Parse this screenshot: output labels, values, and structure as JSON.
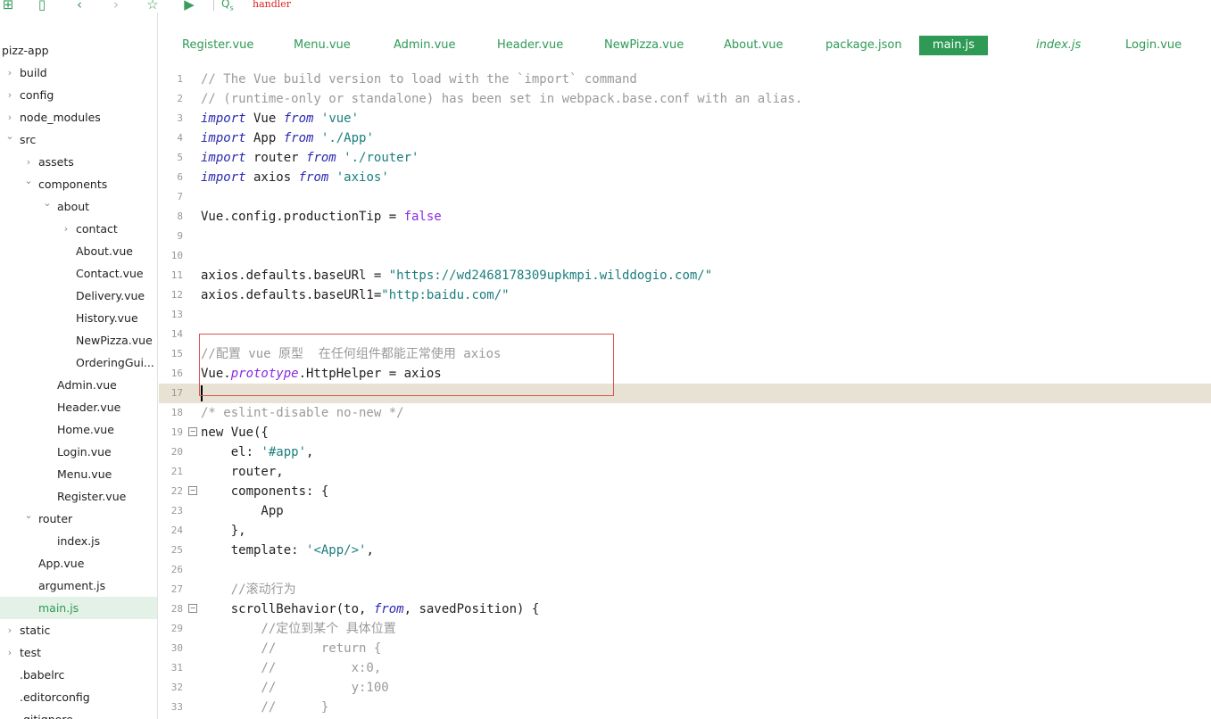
{
  "toolbar": {
    "search_text": "handler",
    "icons": [
      "new-file-icon",
      "save-icon",
      "back-icon",
      "forward-icon",
      "star-icon",
      "run-icon",
      "search-icon"
    ]
  },
  "sidebar": {
    "items": [
      {
        "label": "pizz-app",
        "indent": 0,
        "chevron": ""
      },
      {
        "label": "build",
        "indent": 1,
        "chevron": ">"
      },
      {
        "label": "config",
        "indent": 1,
        "chevron": ">"
      },
      {
        "label": "node_modules",
        "indent": 1,
        "chevron": ">"
      },
      {
        "label": "src",
        "indent": 1,
        "chevron": "v"
      },
      {
        "label": "assets",
        "indent": 2,
        "chevron": ">"
      },
      {
        "label": "components",
        "indent": 2,
        "chevron": "v"
      },
      {
        "label": "about",
        "indent": 3,
        "chevron": "v"
      },
      {
        "label": "contact",
        "indent": 4,
        "chevron": ">"
      },
      {
        "label": "About.vue",
        "indent": 4,
        "chevron": ""
      },
      {
        "label": "Contact.vue",
        "indent": 4,
        "chevron": ""
      },
      {
        "label": "Delivery.vue",
        "indent": 4,
        "chevron": ""
      },
      {
        "label": "History.vue",
        "indent": 4,
        "chevron": ""
      },
      {
        "label": "NewPizza.vue",
        "indent": 4,
        "chevron": ""
      },
      {
        "label": "OrderingGui...",
        "indent": 4,
        "chevron": ""
      },
      {
        "label": "Admin.vue",
        "indent": 3,
        "chevron": ""
      },
      {
        "label": "Header.vue",
        "indent": 3,
        "chevron": ""
      },
      {
        "label": "Home.vue",
        "indent": 3,
        "chevron": ""
      },
      {
        "label": "Login.vue",
        "indent": 3,
        "chevron": ""
      },
      {
        "label": "Menu.vue",
        "indent": 3,
        "chevron": ""
      },
      {
        "label": "Register.vue",
        "indent": 3,
        "chevron": ""
      },
      {
        "label": "router",
        "indent": 2,
        "chevron": "v"
      },
      {
        "label": "index.js",
        "indent": 3,
        "chevron": ""
      },
      {
        "label": "App.vue",
        "indent": 2,
        "chevron": ""
      },
      {
        "label": "argument.js",
        "indent": 2,
        "chevron": ""
      },
      {
        "label": "main.js",
        "indent": 2,
        "chevron": "",
        "active": true
      },
      {
        "label": "static",
        "indent": 1,
        "chevron": ">"
      },
      {
        "label": "test",
        "indent": 1,
        "chevron": ">"
      },
      {
        "label": ".babelrc",
        "indent": 1,
        "chevron": ""
      },
      {
        "label": ".editorconfig",
        "indent": 1,
        "chevron": ""
      },
      {
        "label": ".gitignore",
        "indent": 1,
        "chevron": ""
      }
    ]
  },
  "tabs": [
    {
      "label": "Register.vue"
    },
    {
      "label": "Menu.vue"
    },
    {
      "label": "Admin.vue"
    },
    {
      "label": "Header.vue"
    },
    {
      "label": "NewPizza.vue"
    },
    {
      "label": "About.vue"
    },
    {
      "label": "package.json"
    },
    {
      "label": "main.js",
      "active": true
    },
    {
      "label": "index.js",
      "italic": true
    },
    {
      "label": "Login.vue"
    }
  ],
  "editor": {
    "lines": [
      {
        "n": "1",
        "tokens": [
          [
            "c",
            "// The Vue build version to load with the `import` command"
          ]
        ]
      },
      {
        "n": "2",
        "tokens": [
          [
            "c",
            "// (runtime-only or standalone) has been set in webpack.base.conf with an alias."
          ]
        ]
      },
      {
        "n": "3",
        "tokens": [
          [
            "k",
            "import"
          ],
          [
            "",
            " Vue "
          ],
          [
            "k",
            "from"
          ],
          [
            "",
            " "
          ],
          [
            "s",
            "'vue'"
          ]
        ]
      },
      {
        "n": "4",
        "tokens": [
          [
            "k",
            "import"
          ],
          [
            "",
            " App "
          ],
          [
            "k",
            "from"
          ],
          [
            "",
            " "
          ],
          [
            "s",
            "'./App'"
          ]
        ]
      },
      {
        "n": "5",
        "tokens": [
          [
            "k",
            "import"
          ],
          [
            "",
            " router "
          ],
          [
            "k",
            "from"
          ],
          [
            "",
            " "
          ],
          [
            "s",
            "'./router'"
          ]
        ]
      },
      {
        "n": "6",
        "tokens": [
          [
            "k",
            "import"
          ],
          [
            "",
            " axios "
          ],
          [
            "k",
            "from"
          ],
          [
            "",
            " "
          ],
          [
            "s",
            "'axios'"
          ]
        ]
      },
      {
        "n": "7",
        "tokens": []
      },
      {
        "n": "8",
        "tokens": [
          [
            "",
            "Vue.config.productionTip = "
          ],
          [
            "b",
            "false"
          ]
        ]
      },
      {
        "n": "9",
        "tokens": []
      },
      {
        "n": "10",
        "tokens": []
      },
      {
        "n": "11",
        "tokens": [
          [
            "",
            "axios.defaults.baseURl = "
          ],
          [
            "s",
            "\"https://wd2468178309upkmpi.wilddogio.com/\""
          ]
        ]
      },
      {
        "n": "12",
        "tokens": [
          [
            "",
            "axios.defaults.baseURl1="
          ],
          [
            "s",
            "\"http:baidu.com/\""
          ]
        ]
      },
      {
        "n": "13",
        "tokens": []
      },
      {
        "n": "14",
        "tokens": []
      },
      {
        "n": "15",
        "tokens": [
          [
            "c",
            "//配置 vue 原型  在任何组件都能正常使用 axios"
          ]
        ]
      },
      {
        "n": "16",
        "tokens": [
          [
            "",
            "Vue."
          ],
          [
            "p",
            "prototype"
          ],
          [
            "",
            ".HttpHelper = axios"
          ]
        ]
      },
      {
        "n": "17",
        "tokens": [],
        "cursor": true
      },
      {
        "n": "18",
        "tokens": [
          [
            "c",
            "/* eslint-disable no-new */"
          ]
        ]
      },
      {
        "n": "19",
        "tokens": [
          [
            "",
            "new Vue({"
          ]
        ],
        "fold": "-"
      },
      {
        "n": "20",
        "tokens": [
          [
            "",
            "    el: "
          ],
          [
            "s",
            "'#app'"
          ],
          [
            "",
            ","
          ]
        ]
      },
      {
        "n": "21",
        "tokens": [
          [
            "",
            "    router,"
          ]
        ]
      },
      {
        "n": "22",
        "tokens": [
          [
            "",
            "    components: {"
          ]
        ],
        "fold": "-"
      },
      {
        "n": "23",
        "tokens": [
          [
            "",
            "        App"
          ]
        ]
      },
      {
        "n": "24",
        "tokens": [
          [
            "",
            "    },"
          ]
        ]
      },
      {
        "n": "25",
        "tokens": [
          [
            "",
            "    template: "
          ],
          [
            "s",
            "'<App/>'"
          ],
          [
            "",
            ","
          ]
        ]
      },
      {
        "n": "26",
        "tokens": []
      },
      {
        "n": "27",
        "tokens": [
          [
            "c",
            "    //滚动行为"
          ]
        ]
      },
      {
        "n": "28",
        "tokens": [
          [
            "",
            "    scrollBehavior(to, "
          ],
          [
            "k",
            "from"
          ],
          [
            "",
            ", savedPosition) {"
          ]
        ],
        "fold": "-"
      },
      {
        "n": "29",
        "tokens": [
          [
            "c",
            "        //定位到某个 具体位置"
          ]
        ]
      },
      {
        "n": "30",
        "tokens": [
          [
            "c",
            "        //      return {"
          ]
        ]
      },
      {
        "n": "31",
        "tokens": [
          [
            "c",
            "        //          x:0,"
          ]
        ]
      },
      {
        "n": "32",
        "tokens": [
          [
            "c",
            "        //          y:100"
          ]
        ]
      },
      {
        "n": "33",
        "tokens": [
          [
            "c",
            "        //      }"
          ]
        ]
      }
    ]
  }
}
